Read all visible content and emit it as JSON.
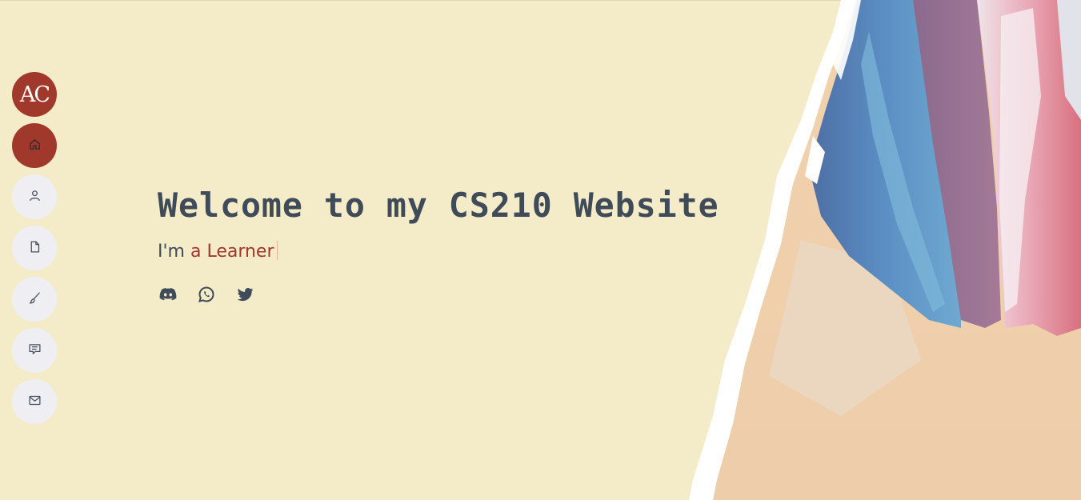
{
  "logo": {
    "text": "AC"
  },
  "sidebar": {
    "items": [
      {
        "name": "home",
        "icon": "home-icon",
        "active": true
      },
      {
        "name": "about",
        "icon": "user-icon",
        "active": false
      },
      {
        "name": "resume",
        "icon": "document-icon",
        "active": false
      },
      {
        "name": "portfolio",
        "icon": "brush-icon",
        "active": false
      },
      {
        "name": "comments",
        "icon": "chat-icon",
        "active": false
      },
      {
        "name": "contact",
        "icon": "mail-icon",
        "active": false
      }
    ]
  },
  "hero": {
    "title": "Welcome to my CS210 Website",
    "prefix": "I'm",
    "role": "a Learner"
  },
  "socials": [
    {
      "name": "discord",
      "icon": "discord-icon"
    },
    {
      "name": "whatsapp",
      "icon": "whatsapp-icon"
    },
    {
      "name": "twitter",
      "icon": "twitter-icon"
    }
  ],
  "colors": {
    "background": "#f4ebc9",
    "accent": "#a0392b",
    "text": "#3f4b58",
    "nav_bg": "#efeef3"
  }
}
